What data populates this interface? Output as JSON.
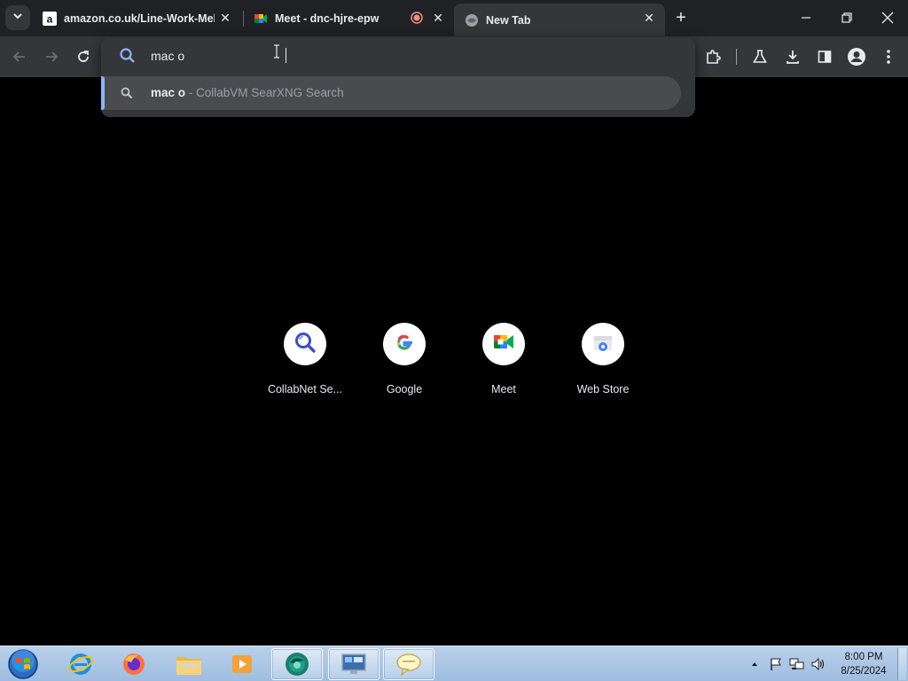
{
  "browser": {
    "tabs": [
      {
        "title": "amazon.co.uk/Line-Work-Melv",
        "favicon": "amazon-icon",
        "active": false
      },
      {
        "title": "Meet - dnc-hjre-epw",
        "favicon": "meet-icon",
        "active": false,
        "recording": true
      },
      {
        "title": "New Tab",
        "favicon": "globe-icon",
        "active": true
      }
    ],
    "omnibox": {
      "value": "mac o",
      "suggestion_query": "mac o",
      "suggestion_separator": " - ",
      "suggestion_engine": "CollabVM SearXNG Search"
    }
  },
  "new_tab": {
    "shortcuts": [
      {
        "label": "CollabNet Se...",
        "icon": "search-icon"
      },
      {
        "label": "Google",
        "icon": "google-icon"
      },
      {
        "label": "Meet",
        "icon": "meet-icon"
      },
      {
        "label": "Web Store",
        "icon": "webstore-icon"
      }
    ]
  },
  "taskbar": {
    "apps": [
      "internet-explorer",
      "firefox",
      "file-explorer",
      "media-player",
      "chrome",
      "remote-desktop",
      "messenger"
    ],
    "clock_time": "8:00 PM",
    "clock_date": "8/25/2024"
  },
  "colors": {
    "tabstrip_bg": "#202124",
    "toolbar_bg": "#35363a",
    "accent": "#8ab4f8",
    "page_bg": "#000000"
  }
}
